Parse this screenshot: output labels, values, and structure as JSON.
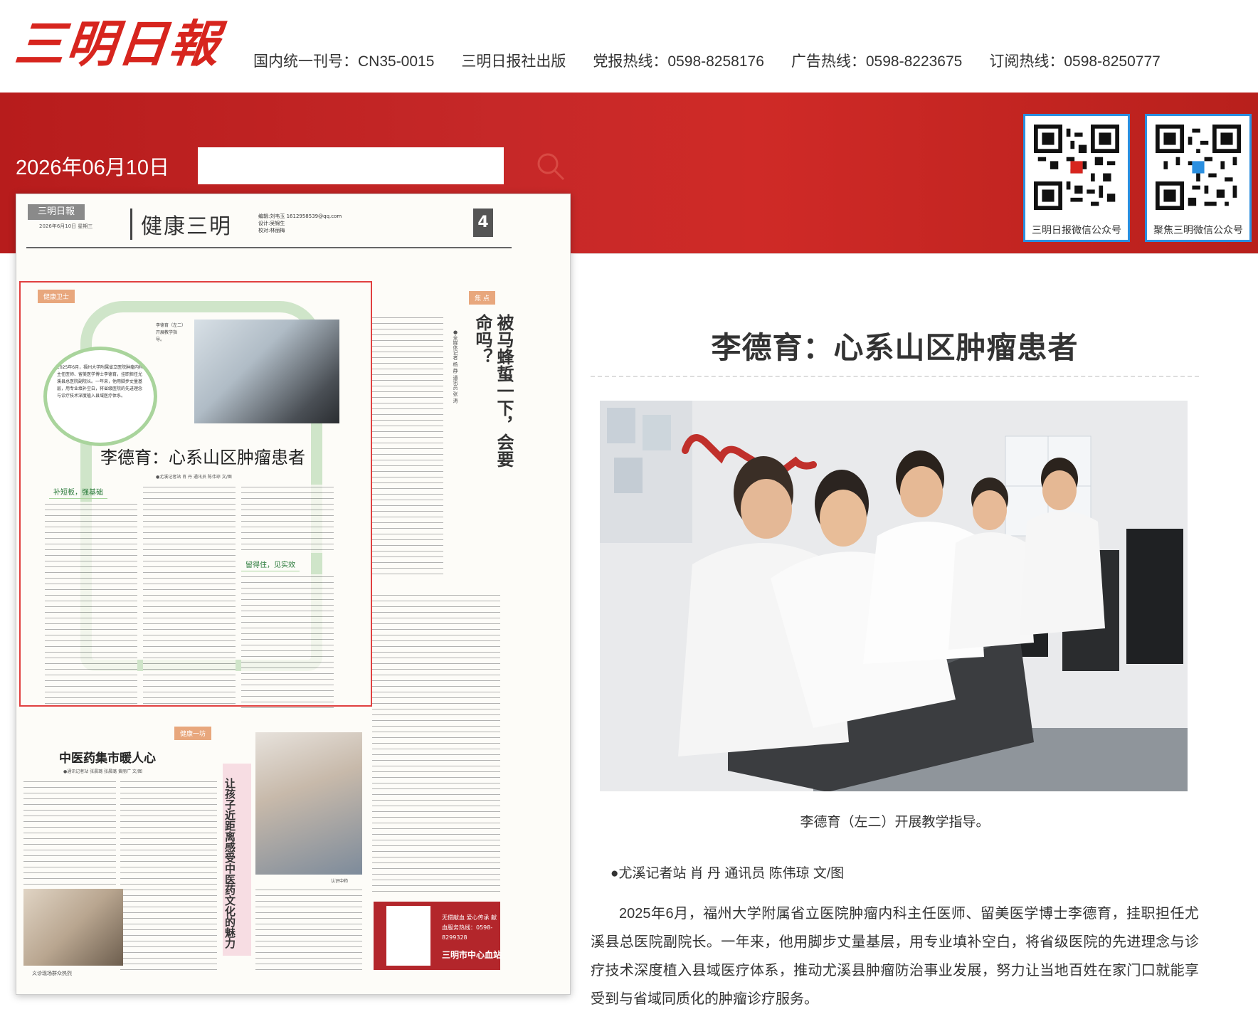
{
  "header": {
    "logo_text": "三明日報",
    "info": [
      "国内统一刊号：CN35-0015",
      "三明日报社出版",
      "党报热线：0598-8258176",
      "广告热线：0598-8223675",
      "订阅热线：0598-8250777"
    ]
  },
  "banner": {
    "date": "2026年06月10日",
    "search_placeholder": "",
    "qr_codes": [
      {
        "label": "三明日报微信公众号",
        "icon": "qr-code-icon"
      },
      {
        "label": "聚焦三明微信公众号",
        "icon": "qr-code-icon"
      }
    ],
    "colors": {
      "accent": "#c62828",
      "qr_border": "#2a8fe0"
    }
  },
  "newspaper": {
    "logo": "三明日報",
    "date_line": "2026年6月10日 星期三",
    "section": "健康三明",
    "editor_lines": [
      "编辑:刘韦玉 1612958539@qq.com",
      "设计:吴锦生",
      "校对:林丽梅"
    ],
    "page_number": "4",
    "tag_1": "健康卫士",
    "circle_text": "2025年6月，福州大学附属省立医院肿瘤内科主任医师、留美医学博士李德育，挂职担任尤溪县总医院副院长。一年来，他用脚步丈量基层，用专业填补空白，将省级医院的先进理念与诊疗技术深度植入县域医疗体系。",
    "photo_caption": "李德育（左二）开展教学指导。",
    "headline": "李德育：心系山区肿瘤患者",
    "byline": "●尤溪记者站 肖 丹 通讯员 陈伟琼 文/图",
    "subheads": [
      "补短板，强基础",
      "留得住，见实效"
    ],
    "focus_tag": "焦 点",
    "focus_title": "被马蜂蜇一下，会要命吗？",
    "focus_byline": "●全媒体记者 杨 静 通讯员 张 涛",
    "tcm_tag": "健康一坊",
    "tcm_title": "中医药集市暖人心",
    "tcm_byline": "●通讯记者站 张晨璐 张晨璐 黄丽广 文/图",
    "tcm_photo_caption": "义诊现场群众热烈",
    "kids_title": "让孩子近距离感受中医药文化的魅力",
    "kids_caption": "认识中药",
    "ad_text": "无偿献血 爱心传承 献血服务热线：0598-8299328",
    "ad_brand": "三明市中心血站"
  },
  "article": {
    "title": "李德育：心系山区肿瘤患者",
    "photo_caption": "李德育（左二）开展教学指导。",
    "byline": "●尤溪记者站 肖 丹 通讯员 陈伟琼 文/图",
    "paragraph": "2025年6月，福州大学附属省立医院肿瘤内科主任医师、留美医学博士李德育，挂职担任尤溪县总医院副院长。一年来，他用脚步丈量基层，用专业填补空白，将省级医院的先进理念与诊疗技术深度植入县域医疗体系，推动尤溪县肿瘤防治事业发展，努力让当地百姓在家门口就能享受到与省域同质化的肿瘤诊疗服务。"
  }
}
